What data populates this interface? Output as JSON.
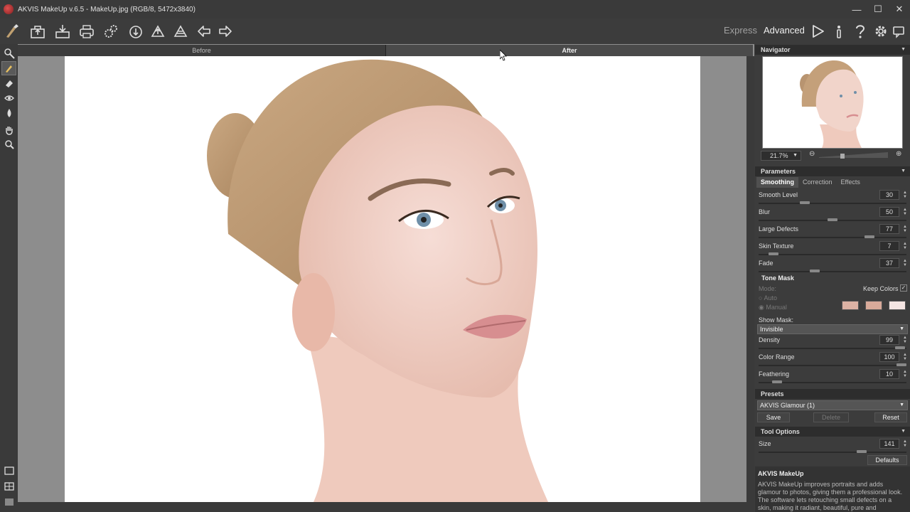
{
  "window": {
    "title": "AKVIS MakeUp v.6.5 - MakeUp.jpg (RGB/8, 5472x3840)",
    "controls": [
      "—",
      "☐",
      "✕"
    ]
  },
  "toolbar": {
    "modes": {
      "express": "Express",
      "advanced": "Advanced"
    },
    "icons": [
      "open-image-icon",
      "save-image-icon",
      "print-icon",
      "batch-processing-icon",
      "load-settings-icon",
      "save-settings-icon",
      "export-icon",
      "undo-arrow-icon",
      "redo-arrow-icon",
      "run-icon",
      "info-icon",
      "help-icon",
      "preferences-gear-icon",
      "notifications-icon"
    ]
  },
  "left_tools": [
    "makeup-tool-icon",
    "brush-icon",
    "eraser-icon",
    "eye-icon",
    "drop-icon",
    "hand-icon",
    "zoom-icon"
  ],
  "canvas": {
    "tabs": {
      "before": "Before",
      "after": "After"
    }
  },
  "navigator": {
    "header": "Navigator",
    "zoom": "21.7%"
  },
  "parameters": {
    "header": "Parameters",
    "tabs": [
      "Smoothing",
      "Correction",
      "Effects"
    ],
    "active_tab": "Smoothing",
    "sliders": [
      {
        "label": "Smooth Level",
        "value": "30",
        "pos": 0.3
      },
      {
        "label": "Blur",
        "value": "50",
        "pos": 0.5
      },
      {
        "label": "Large Defects",
        "value": "77",
        "pos": 0.77
      },
      {
        "label": "Skin Texture",
        "value": "7",
        "pos": 0.07
      },
      {
        "label": "Fade",
        "value": "37",
        "pos": 0.37
      }
    ],
    "tone_mask": {
      "header": "Tone Mask",
      "mode_label": "Mode:",
      "keep_colors_label": "Keep Colors",
      "keep_colors_checked": true,
      "auto_label": "Auto",
      "manual_label": "Manual",
      "swatch_colors": [
        "#dcb2a4",
        "#d8aa9a",
        "#f4e4e2"
      ],
      "show_mask_label": "Show Mask:",
      "show_mask_value": "Invisible",
      "sliders": [
        {
          "label": "Density",
          "value": "99",
          "pos": 0.99
        },
        {
          "label": "Color Range",
          "value": "100",
          "pos": 1.0
        },
        {
          "label": "Feathering",
          "value": "10",
          "pos": 0.1
        }
      ]
    }
  },
  "presets": {
    "header": "Presets",
    "selected": "AKVIS Glamour (1)",
    "save_label": "Save",
    "delete_label": "Delete",
    "reset_label": "Reset"
  },
  "tool_options": {
    "header": "Tool Options",
    "size_label": "Size",
    "size_value": "141",
    "size_pos": 0.71,
    "defaults_label": "Defaults"
  },
  "about": {
    "header": "AKVIS MakeUp",
    "text": "AKVIS MakeUp improves portraits and adds glamour to photos, giving them a professional look. The software lets retouching small defects on a skin, making it radiant, beautiful, pure and"
  }
}
